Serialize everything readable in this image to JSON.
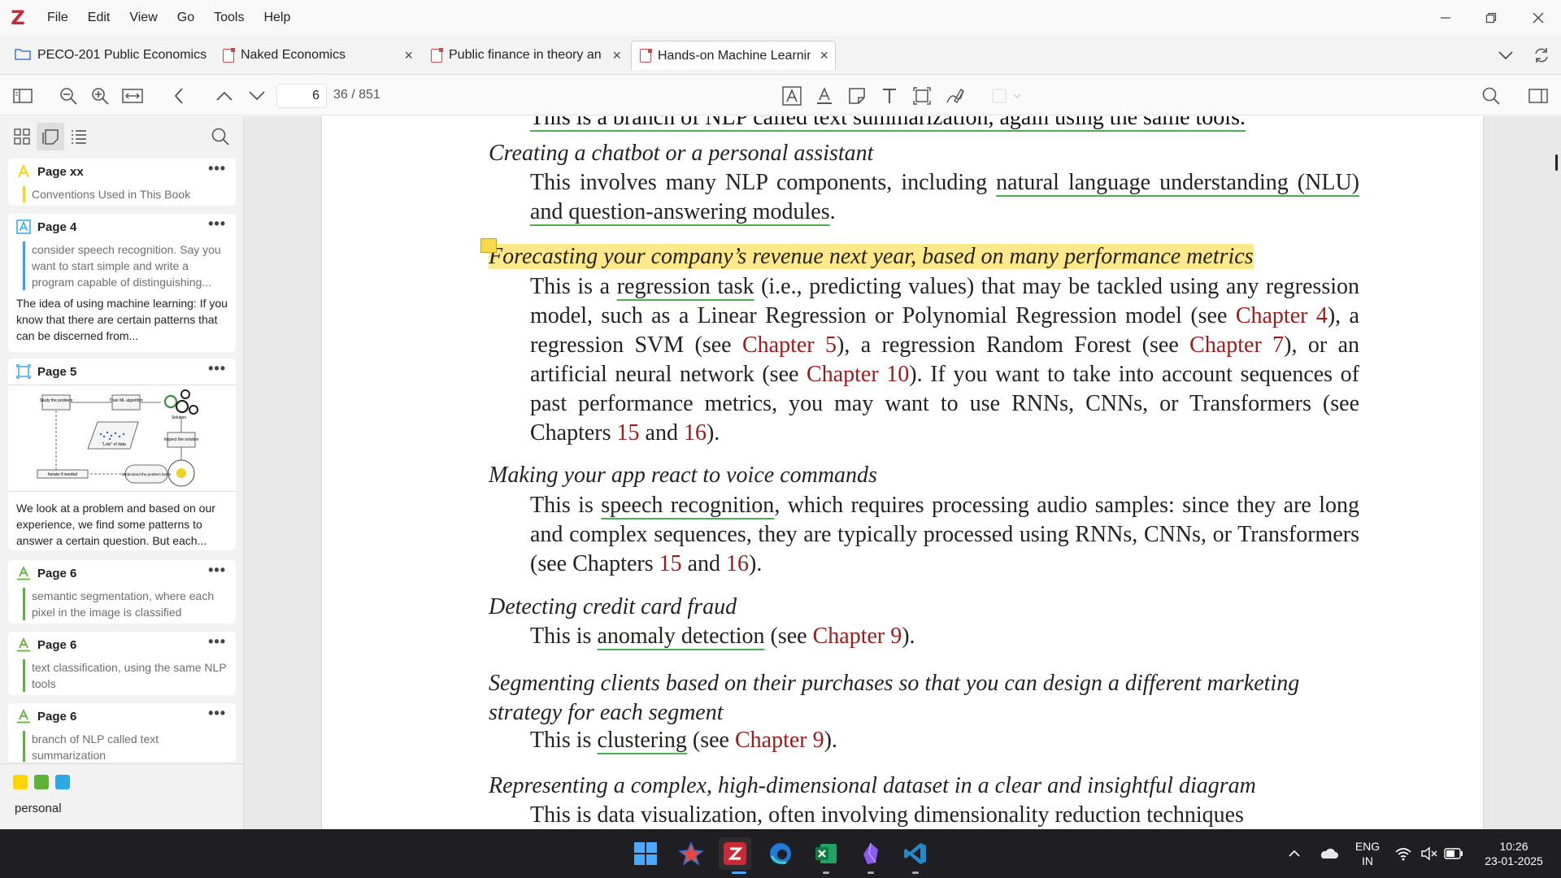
{
  "menubar": {
    "logo": "Z",
    "items": [
      "File",
      "Edit",
      "View",
      "Go",
      "Tools",
      "Help"
    ]
  },
  "tabs": [
    {
      "label": "PECO-201 Public Economics",
      "type": "collection"
    },
    {
      "label": "Naked Economics",
      "type": "pdf"
    },
    {
      "label": "Public finance in theory and practice",
      "type": "pdf"
    },
    {
      "label": "Hands-on Machine Learning",
      "type": "pdf",
      "active": true
    }
  ],
  "toolbar": {
    "page_current": "6",
    "page_total": "36 / 851"
  },
  "sidebar": {
    "annotations": [
      {
        "page": "Page xx",
        "type": "highlight",
        "color": "#ffd400",
        "quote": "Conventions Used in This Book",
        "note": ""
      },
      {
        "page": "Page 4",
        "type": "text",
        "color": "#2ea8e5",
        "quote": "consider speech recognition. Say you want to start simple and write a program capable of distinguishing...",
        "note": "The idea of using machine learning: If you know that there are certain patterns that can be discerned from..."
      },
      {
        "page": "Page 5",
        "type": "image",
        "color": "#2ea8e5",
        "quote": "",
        "note": "We look at a problem and based on our experience, we find some patterns to answer a certain question. But each..."
      },
      {
        "page": "Page 6",
        "type": "underline",
        "color": "#5fb236",
        "quote": "semantic segmentation, where each pixel in the image is classified",
        "note": ""
      },
      {
        "page": "Page 6",
        "type": "underline",
        "color": "#5fb236",
        "quote": "text classification, using the same NLP tools",
        "note": ""
      },
      {
        "page": "Page 6",
        "type": "underline",
        "color": "#5fb236",
        "quote": "branch of NLP called text summarization",
        "note": ""
      }
    ],
    "diagram_labels": {
      "study": "Study the problem",
      "train": "Train ML algorithm",
      "solution": "Solution",
      "data": "\"Lots\" of data",
      "inspect": "Inspect the solution",
      "iterate": "Iterate if needed",
      "understand": "Understand the problem better"
    },
    "tag_colors": [
      "#ffd400",
      "#5fb236",
      "#2ea8e5"
    ],
    "tag": "personal"
  },
  "document": {
    "top_partial": "This is a branch of NLP called text summarization, again using the same tools.",
    "entries": [
      {
        "title": "Creating a chatbot or a personal assistant"
      },
      {
        "title": "Forecasting your company’s revenue next year, based on many performance metrics"
      },
      {
        "title": "Making your app react to voice commands"
      },
      {
        "title": "Detecting credit card fraud"
      },
      {
        "title": "Segmenting clients based on their purchases so that you can design a different marketing strategy for each segment"
      },
      {
        "title": "Representing a complex, high-dimensional dataset in a clear and insightful diagram"
      }
    ],
    "text": {
      "e1_a": "This involves many NLP components, including ",
      "e1_u1": "natural language understanding (NLU) and question-answering modules",
      "e1_b": ".",
      "e2_a": "This is a ",
      "e2_u1": "regression task",
      "e2_b": " (i.e., predicting values) that may be tackled using any regression model, such as a Linear Regression or Polynomial Regression model (see ",
      "e2_r1": "Chapter 4",
      "e2_c": "), a regression SVM (see ",
      "e2_r2": "Chapter 5",
      "e2_d": "), a regression Random Forest (see ",
      "e2_r3": "Chapter 7",
      "e2_e": "), or an artificial neural network (see ",
      "e2_r4": "Chapter 10",
      "e2_f": "). If you want to take into account sequences of past performance metrics, you may want to use RNNs, CNNs, or Transformers (see Chapters ",
      "e2_r5": "15",
      "e2_g": " and ",
      "e2_r6": "16",
      "e2_h": ").",
      "e3_a": "This is ",
      "e3_u1": "speech recognition",
      "e3_b": ", which requires processing audio samples: since they are long and complex sequences, they are typically processed using RNNs, CNNs, or Transformers (see Chapters ",
      "e3_r1": "15",
      "e3_c": " and ",
      "e3_r2": "16",
      "e3_d": ").",
      "e4_a": "This is ",
      "e4_u1": "anomaly detection",
      "e4_b": " (see ",
      "e4_r1": "Chapter 9",
      "e4_c": ").",
      "e5_a": "This is ",
      "e5_u1": "clustering",
      "e5_b": " (see ",
      "e5_r1": "Chapter 9",
      "e5_c": ").",
      "e6_a": "This is data visualization, often involving dimensionality reduction techniques"
    }
  },
  "taskbar": {
    "lang_top": "ENG",
    "lang_bottom": "IN",
    "time": "10:26",
    "date": "23-01-2025"
  }
}
